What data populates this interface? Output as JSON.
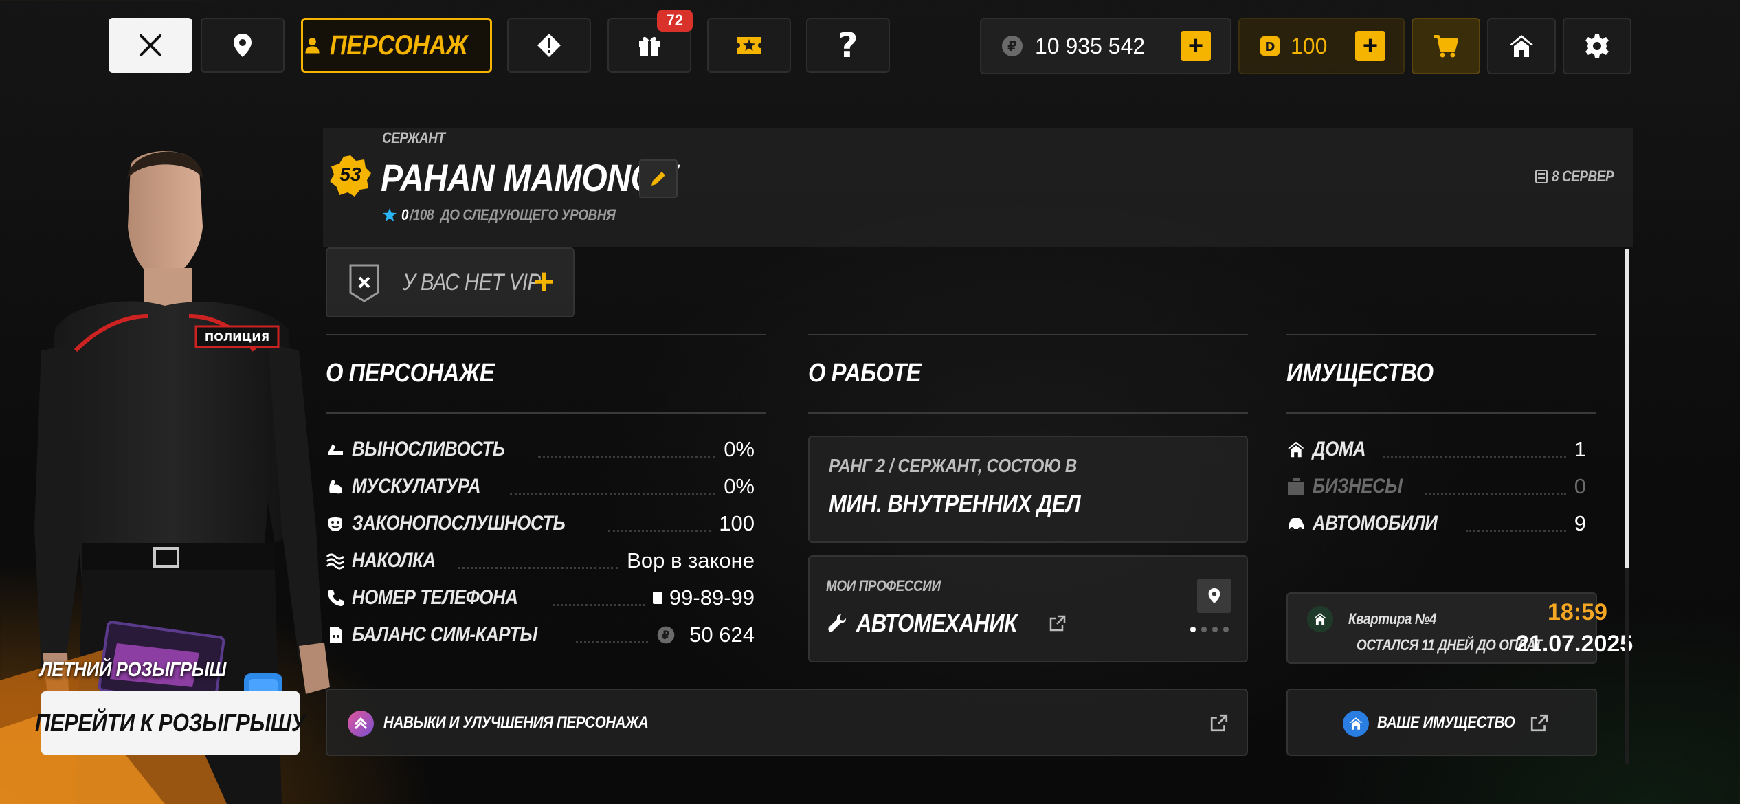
{
  "topbar": {
    "character_tab_label": "ПЕРСОНАЖ",
    "gifts_badge": "72",
    "rubles_balance": "10 935 542",
    "donate_balance": "100"
  },
  "character": {
    "rank": "СЕРЖАНТ",
    "level": "53",
    "name": "PAHAN MAMONOV",
    "xp_current": "0",
    "xp_total_text": "/108",
    "xp_suffix": "ДО СЛЕДУЮЩЕГО УРОВНЯ",
    "server": "8 СЕРВЕР",
    "vip_text": "У ВАС НЕТ VIP"
  },
  "about": {
    "title": "О ПЕРСОНАЖЕ",
    "rows": [
      {
        "label": "ВЫНОСЛИВОСТЬ",
        "value": "0%",
        "icon": "stamina-icon"
      },
      {
        "label": "МУСКУЛАТУРА",
        "value": "0%",
        "icon": "muscle-icon"
      },
      {
        "label": "ЗАКОНОПОСЛУШНОСТЬ",
        "value": "100",
        "icon": "law-icon"
      },
      {
        "label": "НАКОЛКА",
        "value": "Вор в законе",
        "icon": "tattoo-icon"
      },
      {
        "label": "НОМЕР ТЕЛЕФОНА",
        "value": "99-89-99",
        "icon": "phone-icon"
      },
      {
        "label": "БАЛАНС СИМ-КАРТЫ",
        "value": "50 624",
        "icon": "sim-icon"
      }
    ]
  },
  "work": {
    "title": "О РАБОТЕ",
    "rank_line": "РАНГ 2 / СЕРЖАНТ, СОСТОЮ В",
    "organization": "МИН. ВНУТРЕННИХ ДЕЛ",
    "professions_label": "МОИ ПРОФЕССИИ",
    "profession": "АВТОМЕХАНИК"
  },
  "property": {
    "title": "ИМУЩЕСТВО",
    "rows": [
      {
        "label": "ДОМА",
        "value": "1",
        "icon": "house-icon"
      },
      {
        "label": "БИЗНЕСЫ",
        "value": "0",
        "icon": "business-icon"
      },
      {
        "label": "АВТОМОБИЛИ",
        "value": "9",
        "icon": "car-icon"
      }
    ],
    "apartment_name": "Квартира №4",
    "apartment_time": "18:59",
    "apartment_note": "ОСТАЛСЯ 11 ДНЕЙ ДО ОПЛАТ",
    "apartment_date": "21.07.2025",
    "your_property_label": "ВАШЕ ИМУЩЕСТВО"
  },
  "skills": {
    "label": "НАВЫКИ И УЛУЧШЕНИЯ ПЕРСОНАЖА"
  },
  "promo": {
    "title": "ЛЕТНИЙ РОЗЫГРЫШ",
    "button_label": "ПЕРЕЙТИ К РОЗЫГРЫШУ"
  },
  "colors": {
    "accent": "#f5b400",
    "badge_red": "#d9322b",
    "time_orange": "#f5a623"
  }
}
